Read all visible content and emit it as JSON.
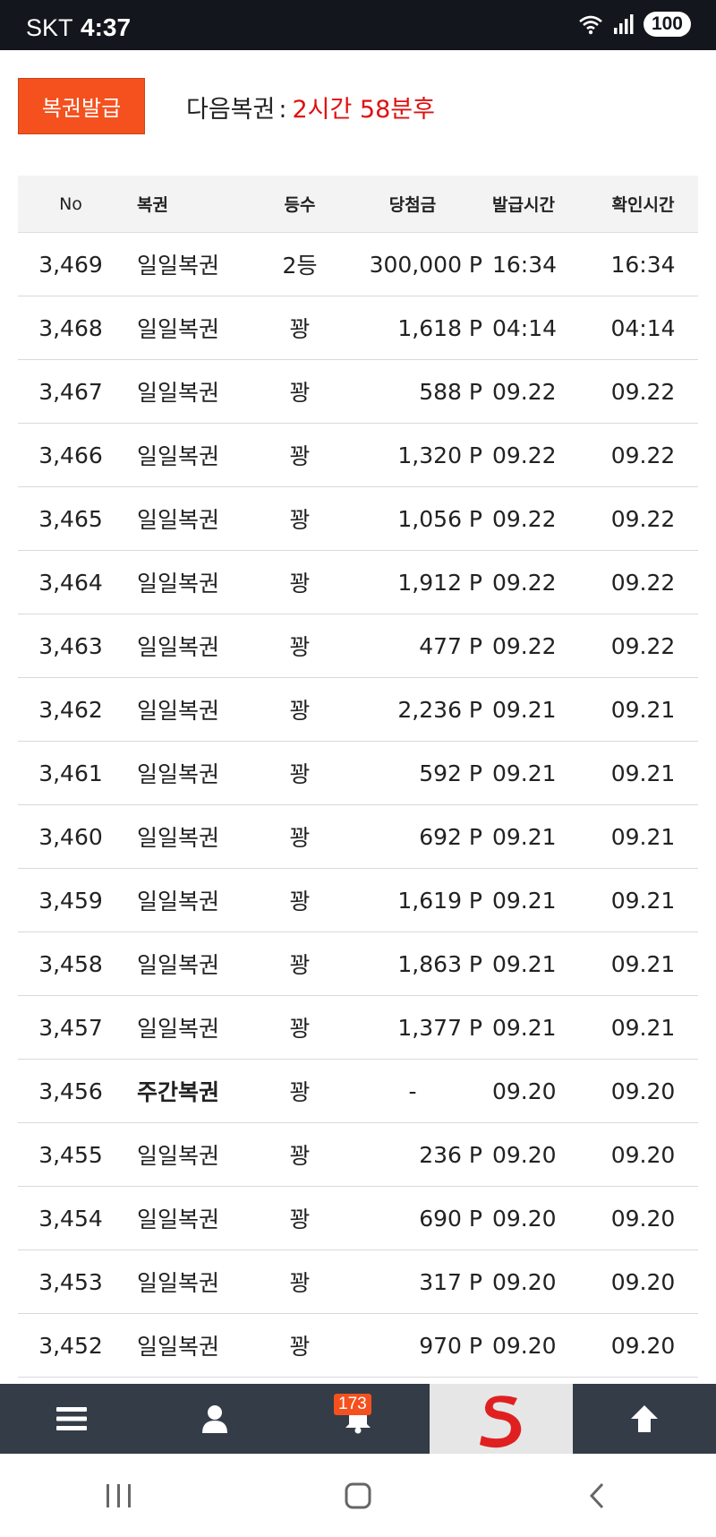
{
  "status_bar": {
    "carrier": "SKT",
    "time": "4:37",
    "battery": "100"
  },
  "issue_button_label": "복권발급",
  "next_ticket": {
    "label": "다음복권",
    "colon": ":",
    "value": "2시간 58분후"
  },
  "table": {
    "headers": {
      "no": "No",
      "kind": "복권",
      "grade": "등수",
      "prize": "당첨금",
      "issued": "발급시간",
      "checked": "확인시간"
    },
    "rows": [
      {
        "no": "3,469",
        "kind": "일일복권",
        "grade": "2등",
        "prize": "300,000 P",
        "issued": "16:34",
        "checked": "16:34"
      },
      {
        "no": "3,468",
        "kind": "일일복권",
        "grade": "꽝",
        "prize": "1,618 P",
        "issued": "04:14",
        "checked": "04:14"
      },
      {
        "no": "3,467",
        "kind": "일일복권",
        "grade": "꽝",
        "prize": "588 P",
        "issued": "09.22",
        "checked": "09.22"
      },
      {
        "no": "3,466",
        "kind": "일일복권",
        "grade": "꽝",
        "prize": "1,320 P",
        "issued": "09.22",
        "checked": "09.22"
      },
      {
        "no": "3,465",
        "kind": "일일복권",
        "grade": "꽝",
        "prize": "1,056 P",
        "issued": "09.22",
        "checked": "09.22"
      },
      {
        "no": "3,464",
        "kind": "일일복권",
        "grade": "꽝",
        "prize": "1,912 P",
        "issued": "09.22",
        "checked": "09.22"
      },
      {
        "no": "3,463",
        "kind": "일일복권",
        "grade": "꽝",
        "prize": "477 P",
        "issued": "09.22",
        "checked": "09.22"
      },
      {
        "no": "3,462",
        "kind": "일일복권",
        "grade": "꽝",
        "prize": "2,236 P",
        "issued": "09.21",
        "checked": "09.21"
      },
      {
        "no": "3,461",
        "kind": "일일복권",
        "grade": "꽝",
        "prize": "592 P",
        "issued": "09.21",
        "checked": "09.21"
      },
      {
        "no": "3,460",
        "kind": "일일복권",
        "grade": "꽝",
        "prize": "692 P",
        "issued": "09.21",
        "checked": "09.21"
      },
      {
        "no": "3,459",
        "kind": "일일복권",
        "grade": "꽝",
        "prize": "1,619 P",
        "issued": "09.21",
        "checked": "09.21"
      },
      {
        "no": "3,458",
        "kind": "일일복권",
        "grade": "꽝",
        "prize": "1,863 P",
        "issued": "09.21",
        "checked": "09.21"
      },
      {
        "no": "3,457",
        "kind": "일일복권",
        "grade": "꽝",
        "prize": "1,377 P",
        "issued": "09.21",
        "checked": "09.21"
      },
      {
        "no": "3,456",
        "kind": "주간복권",
        "grade": "꽝",
        "prize": "-",
        "issued": "09.20",
        "checked": "09.20"
      },
      {
        "no": "3,455",
        "kind": "일일복권",
        "grade": "꽝",
        "prize": "236 P",
        "issued": "09.20",
        "checked": "09.20"
      },
      {
        "no": "3,454",
        "kind": "일일복권",
        "grade": "꽝",
        "prize": "690 P",
        "issued": "09.20",
        "checked": "09.20"
      },
      {
        "no": "3,453",
        "kind": "일일복권",
        "grade": "꽝",
        "prize": "317 P",
        "issued": "09.20",
        "checked": "09.20"
      },
      {
        "no": "3,452",
        "kind": "일일복권",
        "grade": "꽝",
        "prize": "970 P",
        "issued": "09.20",
        "checked": "09.20"
      }
    ]
  },
  "bottom_nav": {
    "items": [
      {
        "name": "menu-icon"
      },
      {
        "name": "user-icon"
      },
      {
        "name": "bell-icon",
        "badge": "173"
      },
      {
        "name": "site-logo-icon"
      },
      {
        "name": "arrow-up-icon"
      }
    ]
  },
  "system_nav": [
    "recent-apps-icon",
    "home-icon",
    "back-icon"
  ],
  "colors": {
    "accent": "#f4511e",
    "next_value": "#e01010",
    "nav_bg": "#343c47",
    "status_bg": "#14161d"
  }
}
